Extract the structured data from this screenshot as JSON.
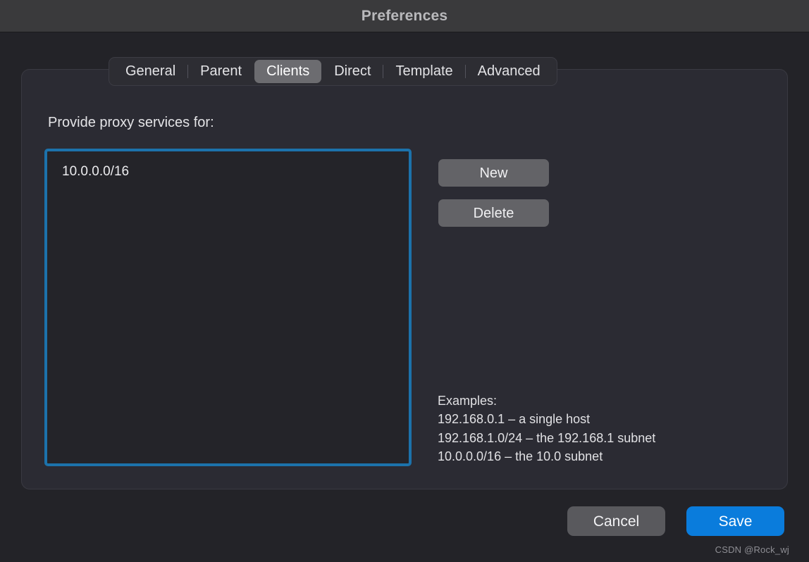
{
  "window": {
    "title": "Preferences"
  },
  "tabs": [
    {
      "id": "general",
      "label": "General",
      "selected": false
    },
    {
      "id": "parent",
      "label": "Parent",
      "selected": false
    },
    {
      "id": "clients",
      "label": "Clients",
      "selected": true
    },
    {
      "id": "direct",
      "label": "Direct",
      "selected": false
    },
    {
      "id": "template",
      "label": "Template",
      "selected": false
    },
    {
      "id": "advanced",
      "label": "Advanced",
      "selected": false
    }
  ],
  "main": {
    "section_label": "Provide proxy services for:",
    "list_items": [
      "10.0.0.0/16"
    ],
    "side_buttons": [
      {
        "id": "new",
        "label": "New"
      },
      {
        "id": "delete",
        "label": "Delete"
      }
    ],
    "examples": {
      "heading": "Examples:",
      "lines": [
        "192.168.0.1 – a single host",
        "192.168.1.0/24 – the 192.168.1 subnet",
        "10.0.0.0/16 – the 10.0 subnet"
      ]
    }
  },
  "footer": {
    "cancel_label": "Cancel",
    "save_label": "Save"
  },
  "watermark": "CSDN @Rock_wj",
  "colors": {
    "window_background": "#232328",
    "titlebar_background": "#3a3a3c",
    "panel_background": "#2b2b33",
    "tab_selected_background": "#6c6c70",
    "list_border_focus": "#1c72ab",
    "list_background": "#242429",
    "button_gray": "#636367",
    "save_blue": "#0a7cdc"
  }
}
